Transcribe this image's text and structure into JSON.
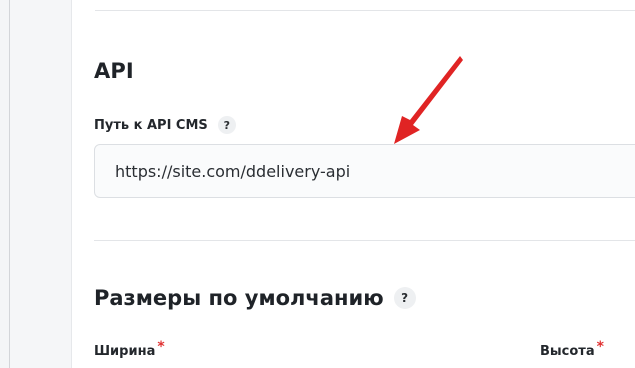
{
  "api_section": {
    "title": "API",
    "path_field": {
      "label": "Путь к API CMS",
      "help": "?",
      "value": "https://site.com/ddelivery-api"
    }
  },
  "defaults_section": {
    "title": "Размеры по умолчанию",
    "help": "?",
    "width_label": "Ширина",
    "height_label": "Высота",
    "required_mark": "*"
  },
  "colors": {
    "arrow": "#e02424",
    "required": "#e03131",
    "text": "#1f2328"
  },
  "icons": {
    "help": "question-circle-icon",
    "annotation": "red-arrow-icon"
  }
}
